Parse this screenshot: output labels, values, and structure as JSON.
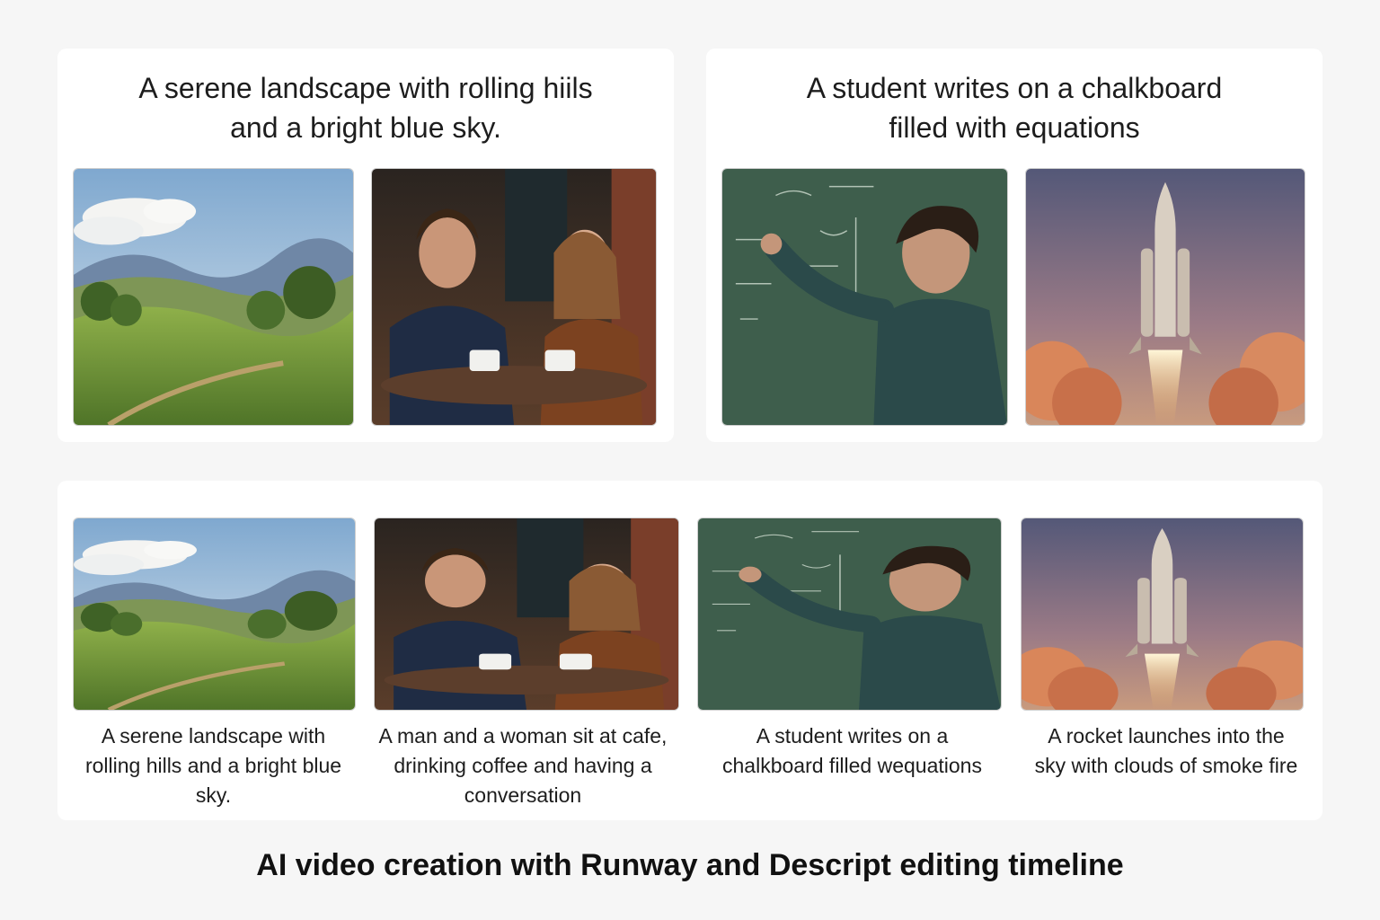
{
  "top_left": {
    "prompt": "A serene landscape with rolling hiils\nand a bright blue sky.",
    "frames": [
      "landscape-frame",
      "cafe-frame"
    ]
  },
  "top_right": {
    "prompt": "A student writes on a chalkboard\nfilled with equations",
    "frames": [
      "chalkboard-frame",
      "rocket-frame"
    ]
  },
  "timeline": {
    "clips": [
      {
        "image": "landscape-frame",
        "caption": "A serene landscape with\nrolling hills and a bright blue\nsky."
      },
      {
        "image": "cafe-frame",
        "caption": "A man and a woman sit at cafe,\ndrinking coffee and having a\nconversation"
      },
      {
        "image": "chalkboard-frame",
        "caption": "A student writes on a\nchalkboard filled wequations"
      },
      {
        "image": "rocket-frame",
        "caption": "A rocket launches into the\nsky with clouds of smoke fire"
      }
    ]
  },
  "footer": {
    "title": "AI video creation with Runway and Descript editing timeline"
  },
  "colors": {
    "background": "#f6f6f6",
    "card": "#ffffff",
    "chalkboard": "#3e5e4c",
    "sky": "#b8d2e6",
    "hills": "#6b8f3a"
  }
}
